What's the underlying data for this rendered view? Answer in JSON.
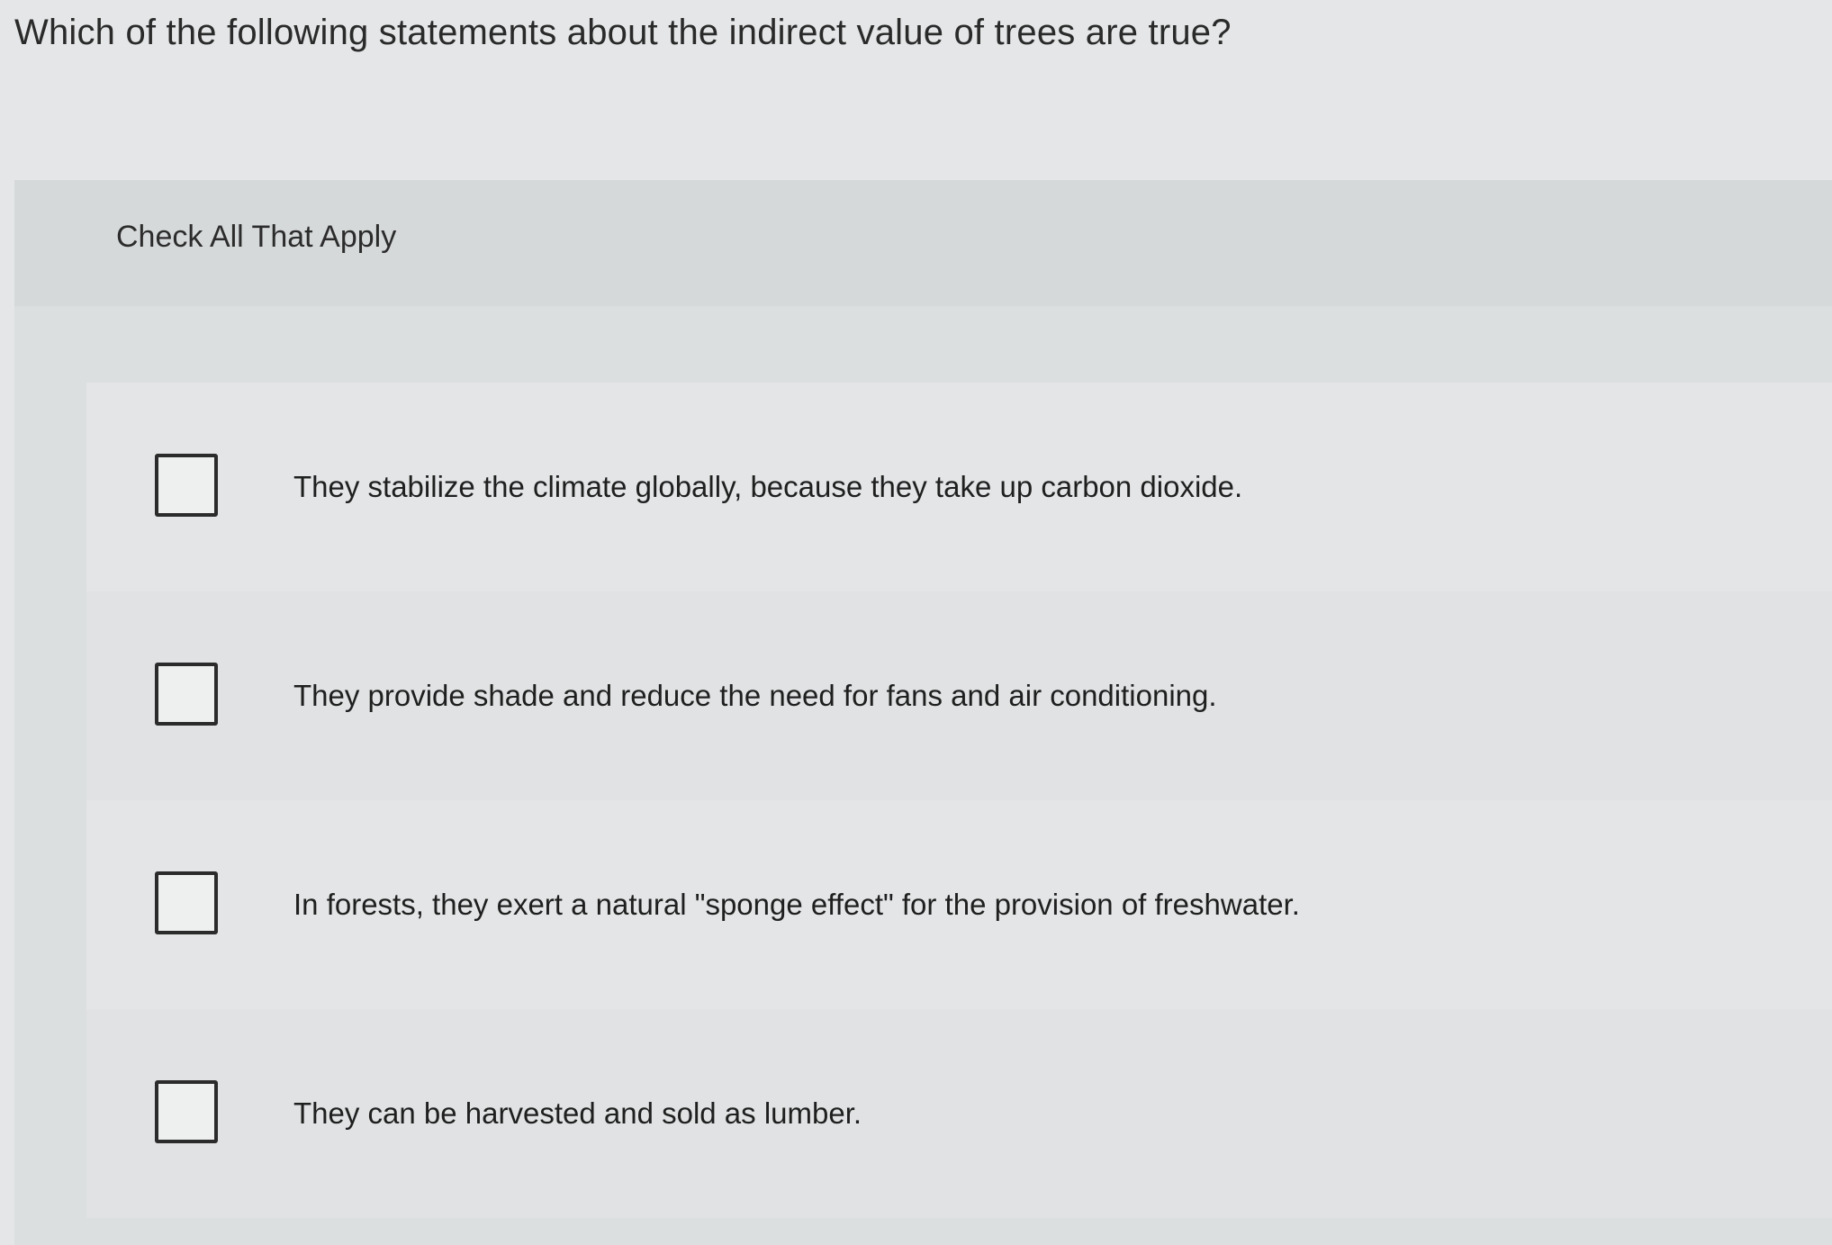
{
  "question": {
    "text": "Which of the following statements about the indirect value of trees are true?"
  },
  "instruction": {
    "text": "Check All That Apply"
  },
  "options": [
    {
      "label": "They stabilize the climate globally, because they take up carbon dioxide.",
      "checked": false
    },
    {
      "label": "They provide shade and reduce the need for fans and air conditioning.",
      "checked": false
    },
    {
      "label": "In forests, they exert a natural \"sponge effect\" for the provision of freshwater.",
      "checked": false
    },
    {
      "label": "They can be harvested and sold as lumber.",
      "checked": false
    }
  ]
}
